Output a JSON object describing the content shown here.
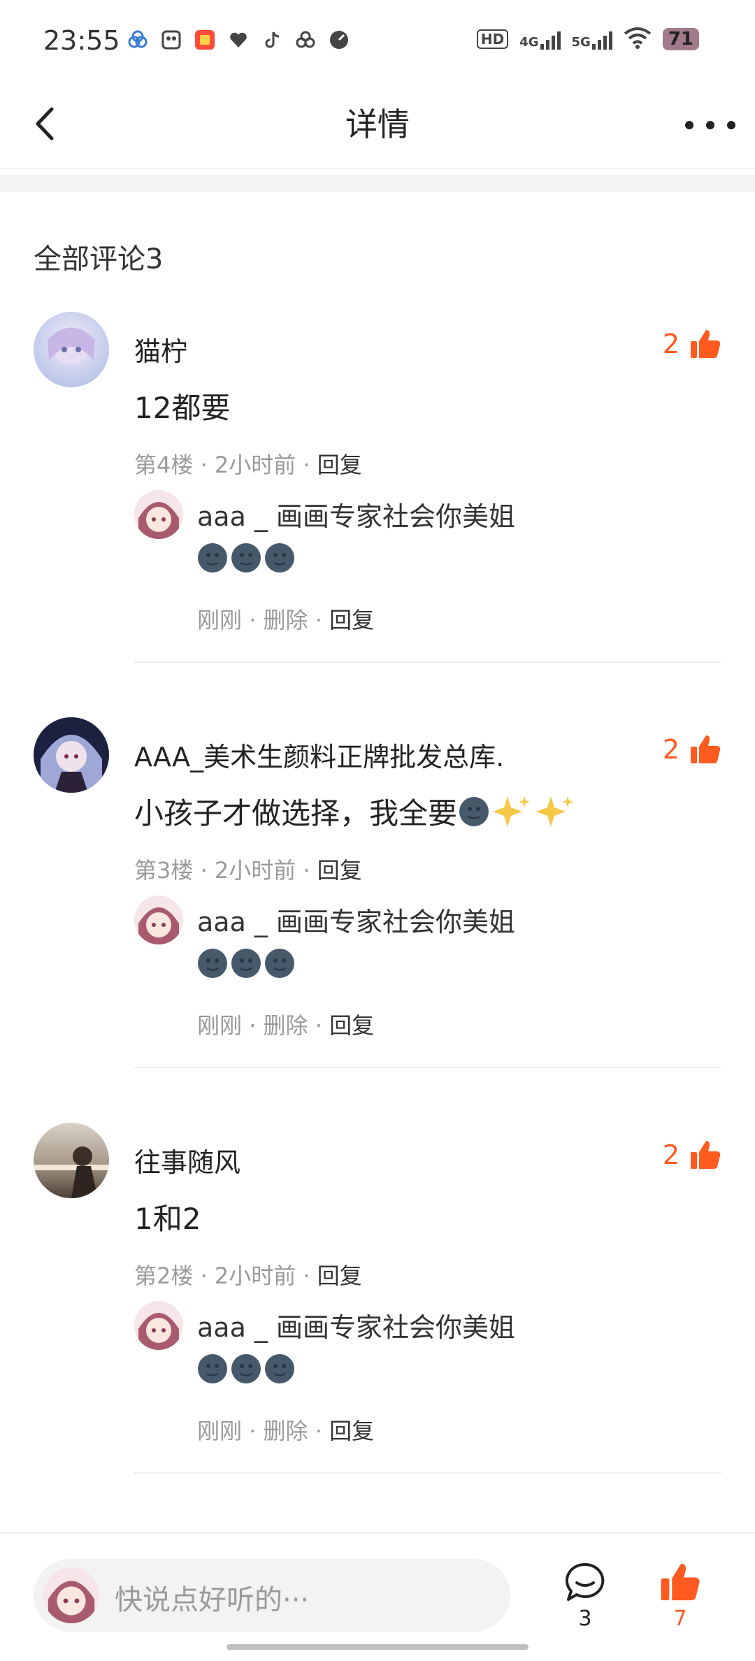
{
  "status_bar": {
    "time": "23:55",
    "hd_label": "HD",
    "net1": "4G",
    "net2": "5G",
    "battery": "71"
  },
  "nav": {
    "title": "详情"
  },
  "section_title": "全部评论3",
  "comments": [
    {
      "username": "猫柠",
      "text": "12都要",
      "floor": "第4楼",
      "time": "2小时前",
      "reply_label": "回复",
      "likes": "2",
      "sub_reply": {
        "username": "aaa _ 画画专家社会你美姐",
        "time": "刚刚",
        "delete_label": "删除",
        "reply_label": "回复"
      }
    },
    {
      "username": "AAA_美术生颜料正牌批发总库.",
      "text": "小孩子才做选择，我全要",
      "floor": "第3楼",
      "time": "2小时前",
      "reply_label": "回复",
      "likes": "2",
      "sub_reply": {
        "username": "aaa _ 画画专家社会你美姐",
        "time": "刚刚",
        "delete_label": "删除",
        "reply_label": "回复"
      }
    },
    {
      "username": "往事随风",
      "text": "1和2",
      "floor": "第2楼",
      "time": "2小时前",
      "reply_label": "回复",
      "likes": "2",
      "sub_reply": {
        "username": "aaa _ 画画专家社会你美姐",
        "time": "刚刚",
        "delete_label": "删除",
        "reply_label": "回复"
      }
    }
  ],
  "bottom_bar": {
    "placeholder": "快说点好听的···",
    "comment_count": "3",
    "like_count": "7"
  },
  "colors": {
    "accent": "#ff5a1f",
    "muted": "#9a9a9a"
  }
}
